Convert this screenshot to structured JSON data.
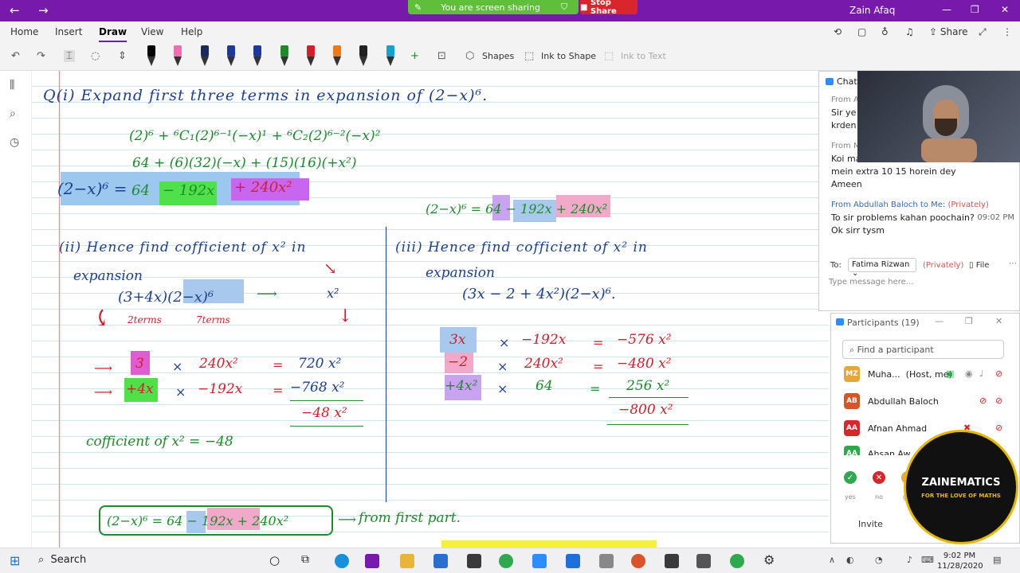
{
  "titlebar": {
    "sharing_text": "You are screen sharing",
    "stop_share": "Stop Share",
    "user": "Zain Afaq"
  },
  "ribbon": {
    "tabs": [
      "Home",
      "Insert",
      "Draw",
      "View",
      "Help"
    ],
    "active_tab": "Draw",
    "share": "Share"
  },
  "toolbar": {
    "shapes": "Shapes",
    "ink_to_shape": "Ink to Shape",
    "ink_to_text": "Ink to Text",
    "pen_colors": [
      "#000000",
      "#f06fb0",
      "#1b2a5a",
      "#1b3a9a",
      "#1b3a9a",
      "#1e8a2c",
      "#d0202c",
      "#f07a1a",
      "#222222",
      "#1aa0d0"
    ]
  },
  "notes": {
    "q1": "Q(i) Expand first three terms in expansion of (2−x)⁶.",
    "q1_line1": "(2)⁶ + ⁶C₁(2)⁶⁻¹(−x)¹ + ⁶C₂(2)⁶⁻²(−x)²",
    "q1_line2": "64 + (6)(32)(−x) + (15)(16)(+x²)",
    "q1_result_lhs": "(2−x)⁶ =",
    "q1_result_64": "64",
    "q1_result_t2": "− 192x",
    "q1_result_t3": "+ 240x²",
    "q1_result_copy": "(2−x)⁶ = 64 − 192x + 240x²",
    "q2_title": "(ii) Hence find cofficient of x² in",
    "q2_title2": "expansion",
    "q2_expr": "(3+4x)(2−x)⁶",
    "q2_arrow_target": "x²",
    "q2_terms_a": "2terms",
    "q2_terms_b": "7terms",
    "q2_rows": [
      {
        "a": "3",
        "op": "×",
        "b": "240x²",
        "eq": "=",
        "r": "720 x²"
      },
      {
        "a": "+4x",
        "op": "×",
        "b": "−192x",
        "eq": "=",
        "r": "−768 x²"
      }
    ],
    "q2_sum": "−48 x²",
    "q2_answer": "cofficient of x² = −48",
    "q3_title": "(iii) Hence find cofficient of x² in",
    "q3_title2": "expansion",
    "q3_expr": "(3x − 2 + 4x²)(2−x)⁶.",
    "q3_rows": [
      {
        "a": "3x",
        "op": "×",
        "b": "−192x",
        "eq": "=",
        "r": "−576 x²"
      },
      {
        "a": "−2",
        "op": "×",
        "b": "240x²",
        "eq": "=",
        "r": "−480 x²"
      },
      {
        "a": "+4x²",
        "op": "×",
        "b": "64",
        "eq": "=",
        "r": "256 x²"
      }
    ],
    "q3_sum": "−800 x²",
    "bottom_box": "(2−x)⁶ = 64 − 192x + 240x²",
    "bottom_note": "from first part."
  },
  "chat": {
    "title": "Chat",
    "messages": [
      {
        "from": "From A",
        "text": "Sir ye\nkrden"
      },
      {
        "from": "From M",
        "text": "Koi ma\nmein extra 10 15 horein dey\nAmeen"
      },
      {
        "from": "From Abdullah Baloch to Me:",
        "priv": "(Privately)",
        "time": "09:02 PM",
        "text": "To sir problems kahan poochain?\nOk sirr tysm"
      }
    ],
    "to_label": "To:",
    "to_value": "Fatima Rizwan",
    "to_priv": "(Privately)",
    "file": "File",
    "input_placeholder": "Type message here..."
  },
  "participants": {
    "title": "Participants (19)",
    "search_placeholder": "Find a participant",
    "list": [
      {
        "initials": "MZ",
        "name": "Muha...",
        "role": "(Host, me)",
        "color": "#e8a53a"
      },
      {
        "initials": "AB",
        "name": "Abdullah Baloch",
        "color": "#d9542b"
      },
      {
        "initials": "AA",
        "name": "Afnan Ahmad",
        "color": "#d9262c"
      },
      {
        "initials": "AA",
        "name": "Ahsan Aw...",
        "color": "#2fa84f"
      }
    ],
    "reactions": [
      "yes",
      "no",
      "go"
    ],
    "invite": "Invite"
  },
  "logo": {
    "name": "ZAINEMATICS",
    "tagline": "FOR THE LOVE OF MATHS"
  },
  "taskbar": {
    "search": "Search",
    "time": "9:02 PM",
    "date": "11/28/2020"
  }
}
